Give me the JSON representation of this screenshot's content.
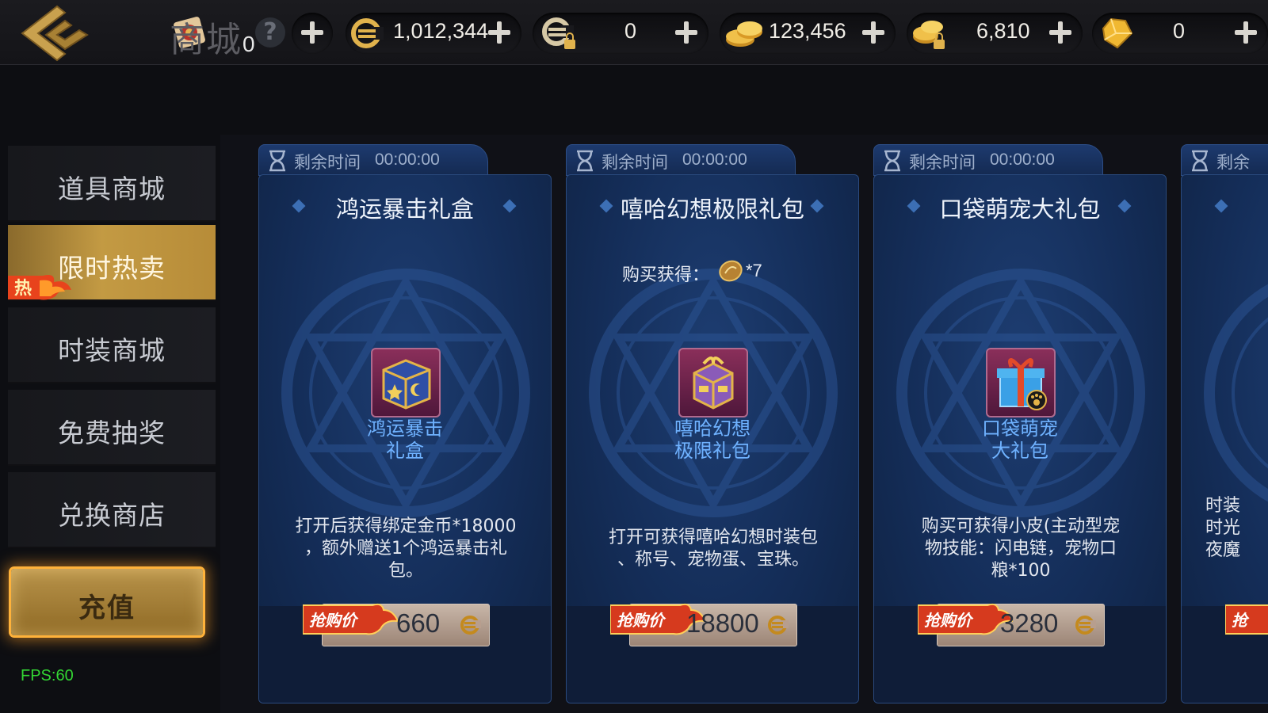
{
  "header": {
    "title": "商城",
    "title_suffix": "0",
    "resources": [
      {
        "icon": "gold-coupon-icon",
        "value": "1,012,344"
      },
      {
        "icon": "bound-coupon-icon",
        "value": "0"
      },
      {
        "icon": "gold-coins-icon",
        "value": "123,456"
      },
      {
        "icon": "bound-gold-coins-icon",
        "value": "6,810"
      },
      {
        "icon": "gem-icon",
        "value": "0"
      }
    ]
  },
  "sidebar": {
    "items": [
      {
        "label": "道具商城"
      },
      {
        "label": "限时热卖",
        "badge": "热"
      },
      {
        "label": "时装商城"
      },
      {
        "label": "免费抽奖"
      },
      {
        "label": "兑换商店"
      }
    ],
    "recharge_label": "充值",
    "fps": "FPS:60"
  },
  "cards": [
    {
      "timer_label": "剩余时间",
      "timer_value": "00:00:00",
      "title": "鸿运暴击礼盒",
      "item_name_1": "鸿运暴击",
      "item_name_2": "礼盒",
      "desc_1": "打开后获得绑定金币*18000",
      "desc_2": "，额外赠送1个鸿运暴击礼",
      "desc_3": "包。",
      "price_tag": "抢购价",
      "price": "660"
    },
    {
      "timer_label": "剩余时间",
      "timer_value": "00:00:00",
      "title": "嘻哈幻想极限礼包",
      "bonus_label": "购买获得：",
      "bonus_qty": "*7",
      "item_name_1": "嘻哈幻想",
      "item_name_2": "极限礼包",
      "desc_1": "打开可获得嘻哈幻想时装包",
      "desc_2": "、称号、宠物蛋、宝珠。",
      "price_tag": "抢购价",
      "price": "18800"
    },
    {
      "timer_label": "剩余时间",
      "timer_value": "00:00:00",
      "title": "口袋萌宠大礼包",
      "item_name_1": "口袋萌宠",
      "item_name_2": "大礼包",
      "desc_1": "购买可获得小皮(主动型宠",
      "desc_2": "物技能：闪电链，宠物口",
      "desc_3": "粮*100",
      "price_tag": "抢购价",
      "price": "3280"
    },
    {
      "timer_label": "剩余",
      "desc_1": "时装",
      "desc_2": "时光",
      "desc_3": "夜魔",
      "price_tag": "抢"
    }
  ]
}
